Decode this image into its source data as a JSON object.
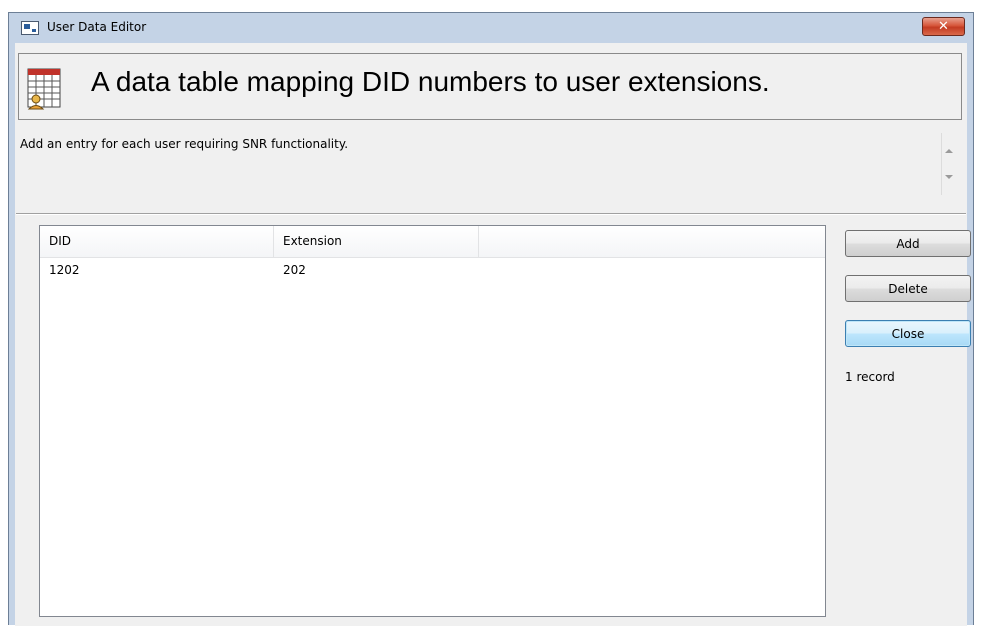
{
  "window": {
    "title": "User Data Editor",
    "close_glyph": "✕"
  },
  "banner": {
    "title": "A data table mapping DID numbers to user extensions.",
    "icon": "table-user-icon"
  },
  "description": {
    "text": "Add an entry for each user requiring SNR functionality."
  },
  "table": {
    "columns": [
      "DID",
      "Extension",
      ""
    ],
    "rows": [
      [
        "1202",
        "202"
      ]
    ]
  },
  "buttons": {
    "add": "Add",
    "delete": "Delete",
    "close": "Close"
  },
  "status": {
    "record_count": "1 record"
  },
  "colors": {
    "frame": "#c4d3e6",
    "client": "#f0f0f0",
    "close_button": "#c7412a",
    "default_button_border": "#3c7fb1"
  }
}
